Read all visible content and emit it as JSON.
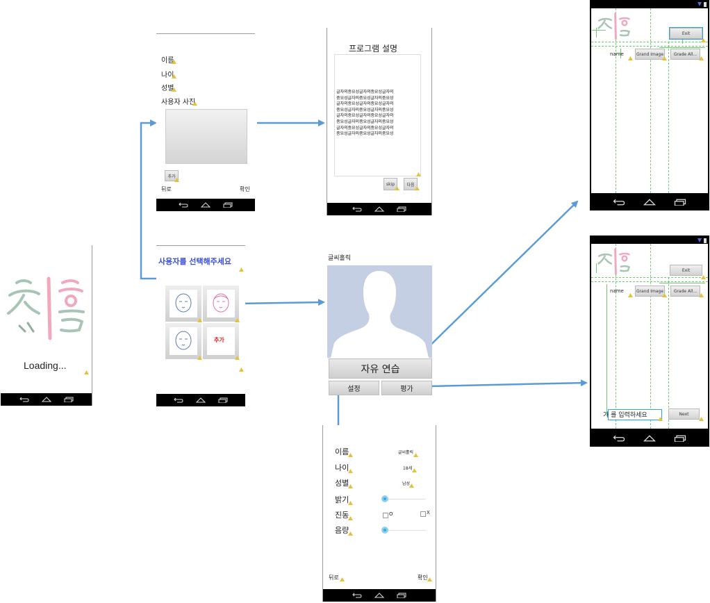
{
  "loading": {
    "text": "Loading..."
  },
  "register": {
    "name": "이름",
    "age": "나이",
    "gender": "성별",
    "photo": "사용자 사진",
    "add": "추가",
    "back": "뒤로",
    "ok": "확인"
  },
  "description": {
    "title": "프로그램 설명",
    "body_lines": [
      "글자의중요성글자의중요성글자의",
      "중요성글자의중요성글자의중요성",
      "글자의중요성글자의중요성글자의",
      "중요성글자의중요성글자의중요성",
      "글자의중요성글자의중요성글자의",
      "중요성글자의중요성글자의중요성",
      "글자의중요성글자의중요성글자의",
      "중요성글자의중요성글자의중요성"
    ],
    "skip": "skip",
    "next": "다음"
  },
  "select_user": {
    "title": "사용자를 선택해주세요",
    "add": "추가"
  },
  "main": {
    "app_title": "글씨홀릭",
    "free_practice": "자유 연습",
    "settings": "설정",
    "evaluate": "평가"
  },
  "layout_editor_top": {
    "exit": "Exit",
    "name": "name",
    "btn1": "Grand Image",
    "btn2": "Grade All..."
  },
  "layout_editor_bottom": {
    "exit": "Exit",
    "name": "name",
    "btn1": "Grand Image",
    "btn2": "Grade All...",
    "input_hint": "가 를 입력하세요",
    "next": "Next"
  },
  "settings": {
    "name_label": "이름",
    "name_value": "글씨홀릭",
    "age_label": "나이",
    "age_value": "18세",
    "gender_label": "성별",
    "gender_value": "남성",
    "brightness": "밝기",
    "vibration": "진동",
    "vib_on": "O",
    "vib_off": "X",
    "volume": "음량",
    "back": "뒤로",
    "ok": "확인"
  },
  "colors": {
    "arrow": "#5b9bd5",
    "guide": "#6ccd6c",
    "title_blue": "#3b4fd6",
    "add_red": "#e02020",
    "avatar_bg": "#c5cfe3",
    "selection": "#29a3e6"
  }
}
